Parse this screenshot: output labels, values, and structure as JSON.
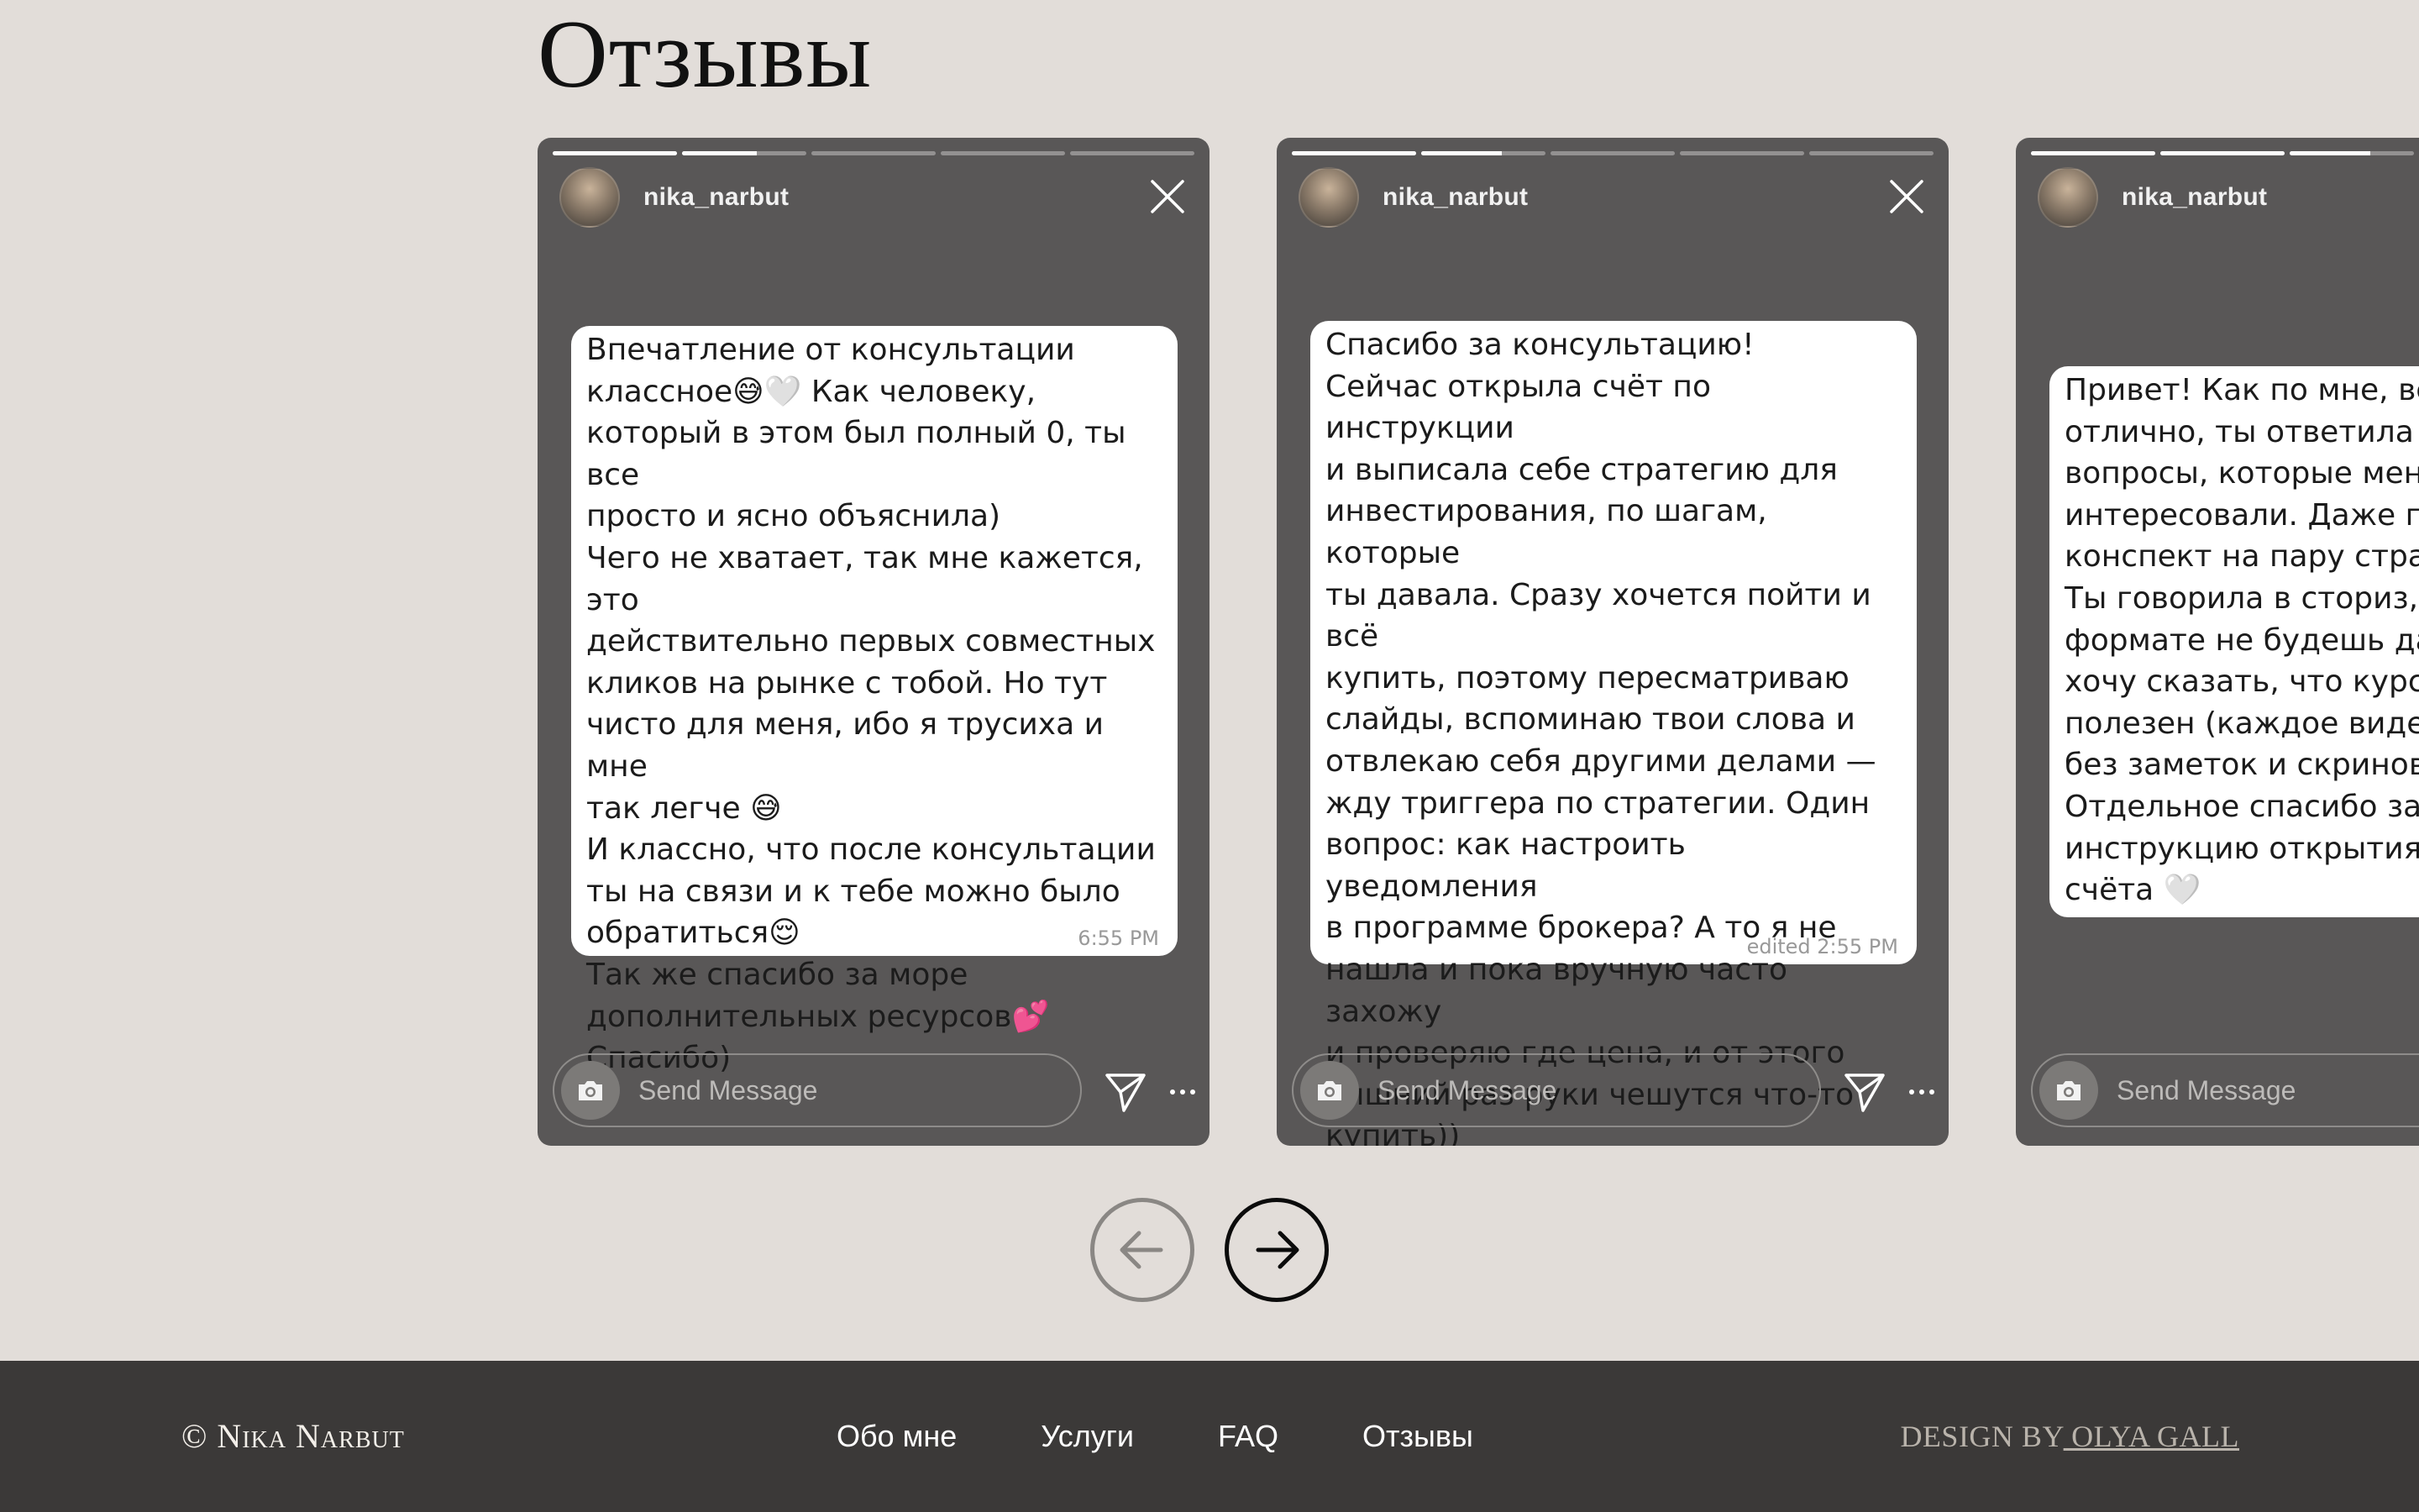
{
  "section": {
    "title": "Отзывы"
  },
  "stories": [
    {
      "username": "nika_narbut",
      "progress": [
        1,
        0.6,
        0,
        0,
        0
      ],
      "message": "Впечатление от консультации\nклассное😅🤍 Как человеку,\nкоторый в этом был полный 0, ты все\nпросто и ясно объяснила)\nЧего не хватает, так мне кажется, это\nдействительно первых совместных\nкликов на рынке с тобой. Но тут\nчисто для меня, ибо я трусиха и мне\nтак легче 😅\nИ классно, что после консультации\nты на связи и к тебе можно было\nобратиться😌\nТак же спасибо за море\nдополнительных ресурсов💕\nСпасибо)",
      "time": "6:55 PM",
      "send_placeholder": "Send Message"
    },
    {
      "username": "nika_narbut",
      "progress": [
        1,
        0.65,
        0,
        0,
        0
      ],
      "message": "Спасибо за консультацию!\nСейчас открыла счёт по инструкции\nи выписала себе стратегию для\nинвестирования, по шагам, которые\nты давала. Сразу хочется пойти и всё\nкупить, поэтому пересматриваю\nслайды, вспоминаю твои слова и\nотвлекаю себя другими делами —\nжду триггера по стратегии. Один\nвопрос: как настроить уведомления\nв программе брокера? А то я не\nнашла и пока вручную часто захожу\nи проверяю где цена, и от этого\nлишний раз руки чешутся что-то\nкупить))",
      "time": "edited 2:55 PM",
      "send_placeholder": "Send Message"
    },
    {
      "username": "nika_narbut",
      "progress": [
        1,
        1,
        0.65,
        0,
        0
      ],
      "message": "Привет! Как по мне, всё\nотлично, ты ответила на\nвопросы, которые меня\nинтересовали. Даже по\nконспект на пару стран\nТы говорила в сториз, ч\nформате не будешь дав\nхочу сказать, что курс о\nполезен (каждое видео\nбез заметок и скринов\nОтдельное спасибо за\nинструкцию открытия б\nсчёта 🤍",
      "time": "",
      "send_placeholder": "Send Message"
    }
  ],
  "nav": {
    "prev": "previous",
    "next": "next"
  },
  "footer": {
    "copyright": "© Nika Narbut",
    "links": [
      "Обо мне",
      "Услуги",
      "FAQ",
      "Отзывы"
    ],
    "credit_prefix": "DESIGN BY",
    "credit_name": " OLYA GALL"
  },
  "colors": {
    "background": "#e2ddd9",
    "story": "#595757",
    "footer": "#3b3938"
  },
  "icons": [
    "close-icon",
    "camera-icon",
    "send-icon",
    "more-icon",
    "arrow-left-icon",
    "arrow-right-icon"
  ]
}
